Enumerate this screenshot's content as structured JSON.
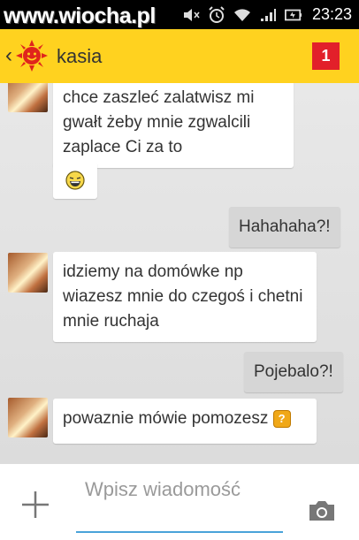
{
  "status_bar": {
    "watermark": "www.wiocha.pl",
    "time": "23:23",
    "icons": [
      "mute-icon",
      "alarm-icon",
      "wifi-icon",
      "signal-icon",
      "battery-icon"
    ]
  },
  "header": {
    "contact_name": "kasia",
    "unread_count": "1",
    "accent_color": "#ffd21f",
    "badge_color": "#e2202a"
  },
  "messages": [
    {
      "side": "in",
      "text": "chce zaszleć zalatwisz mi gwałt żeby mnie zgwalcili zaplace Ci za to"
    },
    {
      "side": "in",
      "emoji": "laughing-emoji"
    },
    {
      "side": "out",
      "text": "Hahahaha?!"
    },
    {
      "side": "in",
      "text": "idziemy na domówke np wiazesz mnie do czegoś i chetni mnie ruchaja"
    },
    {
      "side": "out",
      "text": "Pojebalo?!"
    },
    {
      "side": "in",
      "text": "powaznie mówie pomozesz",
      "emoji": "question-emoji"
    }
  ],
  "composer": {
    "placeholder": "Wpisz wiadomość",
    "icons": [
      "plus-icon",
      "camera-icon"
    ]
  }
}
